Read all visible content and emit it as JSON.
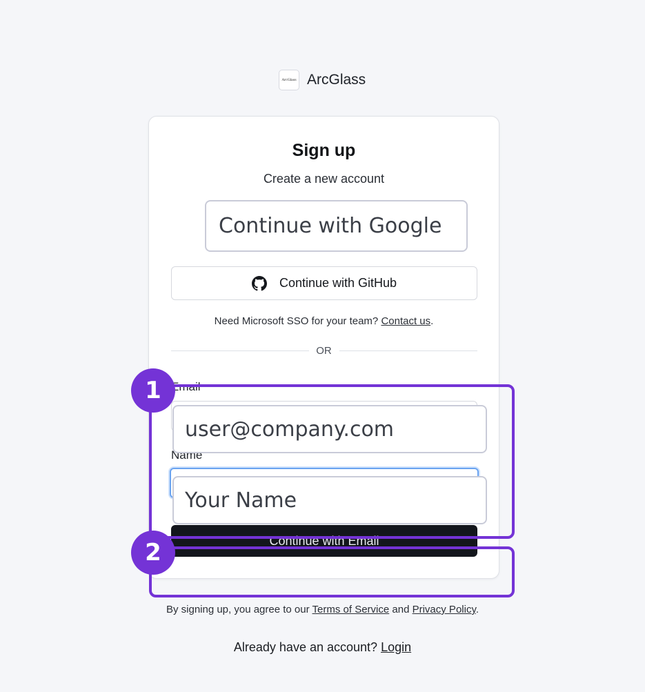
{
  "brand": {
    "name": "ArcGlass",
    "logo_text": "ArcGlass"
  },
  "signup": {
    "title": "Sign up",
    "subtitle": "Create a new account",
    "google_button": "Continue with Google",
    "github_button": "Continue with GitHub",
    "sso_text": "Need Microsoft SSO for your team?",
    "sso_link": "Contact us",
    "sso_period": ".",
    "divider": "OR",
    "email_label": "Email",
    "email_value": "user@company.com",
    "name_label": "Name",
    "name_placeholder": "Your Name",
    "submit_button": "Continue with Email"
  },
  "legal": {
    "prefix": "By signing up, you agree to our",
    "terms_link": "Terms of Service",
    "and": "and",
    "privacy_link": "Privacy Policy",
    "period": "."
  },
  "login": {
    "prompt": "Already have an account?",
    "link": "Login"
  },
  "marks": [
    "1",
    "2"
  ],
  "colors": {
    "mark": "#7433d6",
    "primary_button": "#13161c",
    "focus": "#6aa3f0"
  },
  "icons": {
    "github": "github-icon"
  }
}
